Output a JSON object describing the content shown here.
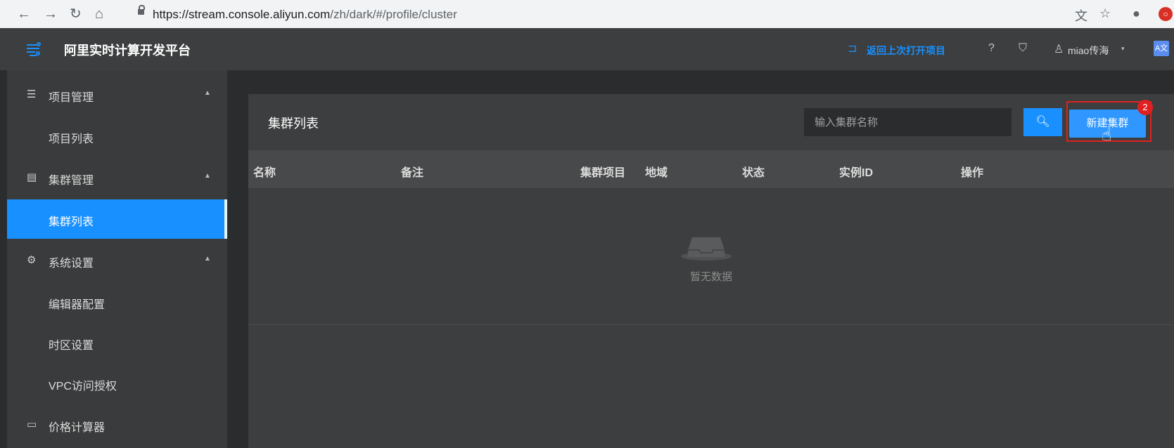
{
  "browser": {
    "url_host": "https://stream.console.aliyun.com",
    "url_path": "/zh/dark/#/profile/cluster",
    "nav_icons": [
      "back-arrow-icon",
      "forward-arrow-icon",
      "reload-icon",
      "home-icon"
    ]
  },
  "header": {
    "app_title": "阿里实时计算开发平台",
    "back_link": "返回上次打开项目",
    "user": "miao传海"
  },
  "sidebar": {
    "groups": [
      {
        "label": "项目管理",
        "icon": "list-icon",
        "items": [
          "项目列表"
        ]
      },
      {
        "label": "集群管理",
        "icon": "cluster-icon",
        "items": [
          "集群列表"
        ]
      },
      {
        "label": "系统设置",
        "icon": "gear-icon",
        "items": [
          "编辑器配置",
          "时区设置",
          "VPC访问授权"
        ]
      },
      {
        "label": "价格计算器",
        "icon": "calculator-icon",
        "items": []
      }
    ],
    "active_item": "集群列表"
  },
  "main": {
    "panel_title": "集群列表",
    "search_placeholder": "输入集群名称",
    "new_button": "新建集群",
    "badge": "2",
    "columns": [
      "名称",
      "备注",
      "集群项目",
      "地域",
      "状态",
      "实例ID",
      "操作"
    ],
    "empty_text": "暂无数据"
  },
  "colors": {
    "accent": "#1890ff",
    "highlight": "#e02020"
  }
}
